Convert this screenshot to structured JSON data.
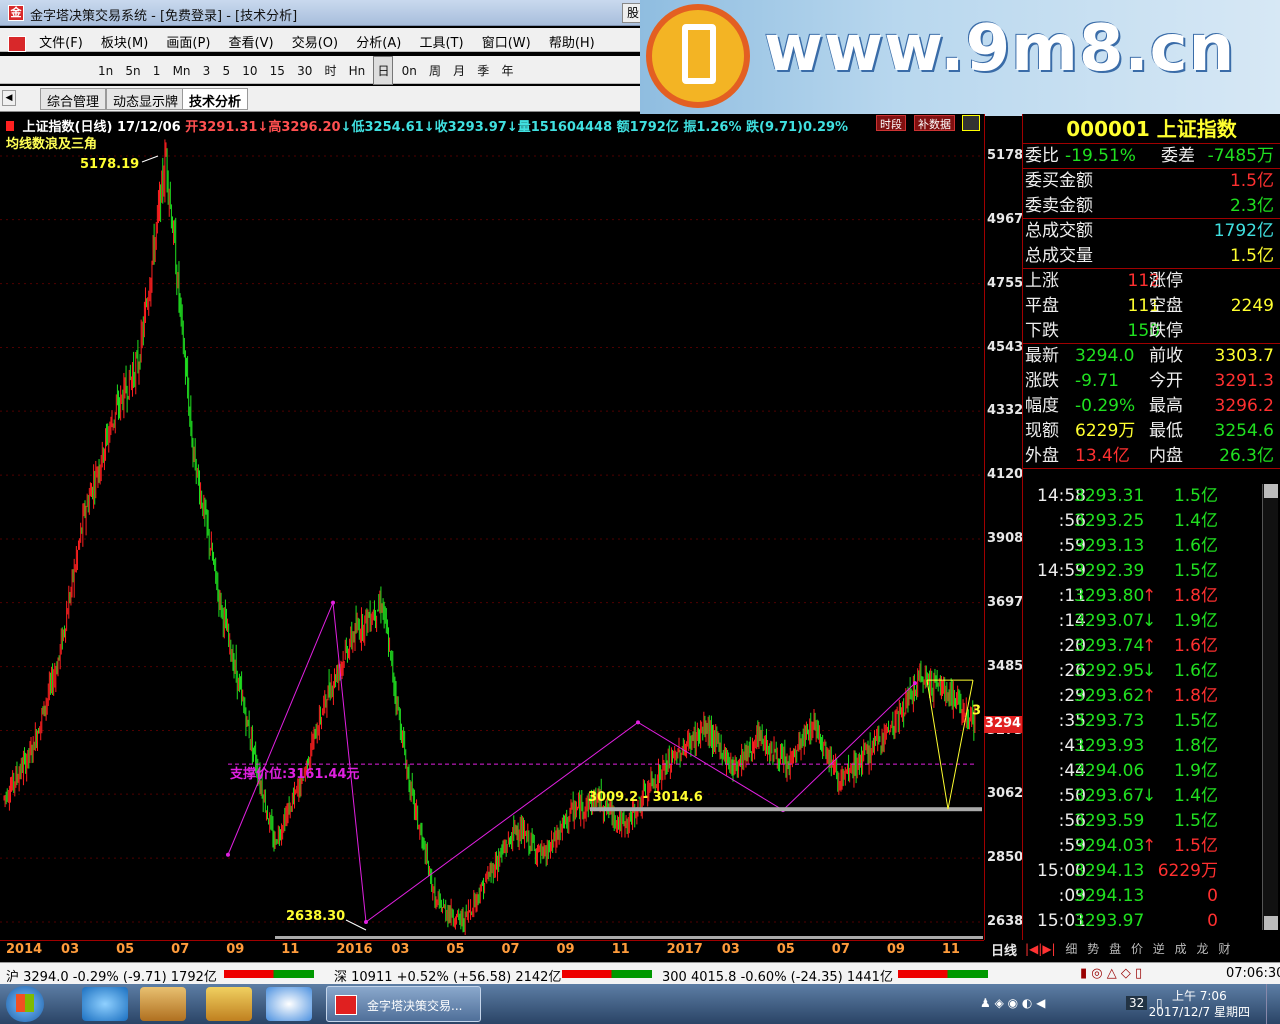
{
  "window": {
    "title": "金字塔决策交易系统 - [免费登录] - [技术分析]",
    "stock_tab": "股"
  },
  "ad": {
    "site": "www.9m8.cn",
    "small": "www.9m8.cn"
  },
  "menu": [
    "文件(F)",
    "板块(M)",
    "画面(P)",
    "查看(V)",
    "交易(O)",
    "分析(A)",
    "工具(T)",
    "窗口(W)",
    "帮助(H)"
  ],
  "toolbar": [
    "1n",
    "5n",
    "1",
    "Mn",
    "3",
    "5",
    "10",
    "15",
    "30",
    "时",
    "Hn",
    "日",
    "0n",
    "周",
    "月",
    "季",
    "年"
  ],
  "tabs": [
    "综合管理",
    "动态显示牌",
    "技术分析"
  ],
  "info": {
    "name": "上证指数(日线)",
    "date": "17/12/06",
    "open": "开3291.31",
    "high": "↓高3296.20",
    "low": "↓低3254.61",
    "close": "↓收3293.97",
    "vol": "↓量151604448",
    "amt": "额1792亿",
    "amp": "振1.26%",
    "chg": "跌(9.71)0.29%",
    "sublabel": "均线数浪及三角",
    "btn1": "时段",
    "btn2": "补数据"
  },
  "colors": {
    "up": "#ff2020",
    "down": "#20e020",
    "purple": "#e020e0",
    "yellow": "#ffff30"
  },
  "chart_data": {
    "type": "candlestick",
    "title": "上证指数(日线)",
    "yticks": [
      "5178",
      "4967",
      "4755",
      "4543",
      "4332",
      "4120",
      "3908",
      "3697",
      "3485",
      "3273",
      "3062",
      "2850",
      "2638"
    ],
    "ylim": [
      2638,
      5178
    ],
    "xticks": [
      "2014",
      "03",
      "05",
      "07",
      "09",
      "11",
      "2016",
      "03",
      "05",
      "07",
      "09",
      "11",
      "2017",
      "03",
      "05",
      "07",
      "09",
      "11"
    ],
    "last_price": "3294",
    "annotations": {
      "peak": "5178.19",
      "trough": "2638.30",
      "support": "支撑价位:3161.44元",
      "range": "3009.2 - 3014.6",
      "right_tag": "3"
    },
    "trend": [
      [
        0,
        3050
      ],
      [
        2,
        3200
      ],
      [
        4,
        3500
      ],
      [
        6,
        4000
      ],
      [
        7,
        4300
      ],
      [
        8,
        4500
      ],
      [
        9,
        5178
      ],
      [
        10,
        4200
      ],
      [
        11,
        3700
      ],
      [
        12,
        3300
      ],
      [
        13,
        2900
      ],
      [
        14,
        3100
      ],
      [
        15,
        3400
      ],
      [
        16,
        3600
      ],
      [
        17,
        3697
      ],
      [
        18,
        3100
      ],
      [
        19,
        2700
      ],
      [
        20,
        2638
      ],
      [
        21,
        2800
      ],
      [
        22,
        2950
      ],
      [
        23,
        2850
      ],
      [
        24,
        3000
      ],
      [
        25,
        3050
      ],
      [
        26,
        2950
      ],
      [
        27,
        3100
      ],
      [
        28,
        3200
      ],
      [
        29,
        3280
      ],
      [
        30,
        3150
      ],
      [
        31,
        3250
      ],
      [
        32,
        3150
      ],
      [
        33,
        3300
      ],
      [
        34,
        3100
      ],
      [
        35,
        3200
      ],
      [
        36,
        3300
      ],
      [
        37,
        3450
      ],
      [
        38,
        3400
      ],
      [
        39,
        3294
      ]
    ]
  },
  "panel": {
    "code": "000001",
    "name": "上证指数",
    "wb": {
      "k1": "委比",
      "v1": "-19.51%",
      "k2": "委差",
      "v2": "-7485万"
    },
    "rows1": [
      [
        "委买金额",
        "1.5亿"
      ],
      [
        "委卖金额",
        "2.3亿"
      ],
      [
        "总成交额",
        "1792亿"
      ],
      [
        "总成交量",
        "1.5亿"
      ]
    ],
    "breadth": [
      [
        "上涨",
        "112",
        "涨停",
        ""
      ],
      [
        "平盘",
        "111",
        "空盘",
        "2249"
      ],
      [
        "下跌",
        "150",
        "跌停",
        ""
      ]
    ],
    "quote": [
      [
        "最新",
        "3294.0",
        "前收",
        "3303.7"
      ],
      [
        "涨跌",
        "-9.71",
        "今开",
        "3291.3"
      ],
      [
        "幅度",
        "-0.29%",
        "最高",
        "3296.2"
      ],
      [
        "现额",
        "6229万",
        "最低",
        "3254.6"
      ],
      [
        "外盘",
        "13.4亿",
        "内盘",
        "26.3亿"
      ]
    ],
    "ticks": [
      [
        "14:58",
        "3293.31",
        "",
        "1.5亿"
      ],
      [
        ":56",
        "3293.25",
        "",
        "1.4亿"
      ],
      [
        ":59",
        "3293.13",
        "",
        "1.6亿"
      ],
      [
        "14:59",
        "3292.39",
        "",
        "1.5亿"
      ],
      [
        ":11",
        "3293.80",
        "↑",
        "1.8亿"
      ],
      [
        ":14",
        "3293.07",
        "↓",
        "1.9亿"
      ],
      [
        ":20",
        "3293.74",
        "↑",
        "1.6亿"
      ],
      [
        ":26",
        "3292.95",
        "↓",
        "1.6亿"
      ],
      [
        ":29",
        "3293.62",
        "↑",
        "1.8亿"
      ],
      [
        ":35",
        "3293.73",
        "",
        "1.5亿"
      ],
      [
        ":41",
        "3293.93",
        "",
        "1.8亿"
      ],
      [
        ":44",
        "3294.06",
        "",
        "1.9亿"
      ],
      [
        ":50",
        "3293.67",
        "↓",
        "1.4亿"
      ],
      [
        ":56",
        "3293.59",
        "",
        "1.5亿"
      ],
      [
        ":59",
        "3294.03",
        "↑",
        "1.5亿"
      ],
      [
        "15:00",
        "3294.13",
        "",
        "6229万"
      ],
      [
        ":09",
        "3294.13",
        "",
        "0"
      ],
      [
        "15:01",
        "3293.97",
        "",
        "0"
      ]
    ],
    "tabs": [
      "细",
      "势",
      "盘",
      "价",
      "逆",
      "成",
      "龙",
      "财"
    ],
    "day_label": "日线"
  },
  "status": {
    "sh": "沪 3294.0 -0.29% (-9.71) 1792亿",
    "sz": "深 10911 +0.52% (+56.58) 2142亿",
    "s300": "300 4015.8 -0.60% (-24.35) 1441亿",
    "time": "07:06:30"
  },
  "taskbar": {
    "task": "金字塔决策交易...",
    "clock_time": "上午 7:06",
    "clock_date": "2017/12/7 星期四",
    "badge": "32"
  }
}
